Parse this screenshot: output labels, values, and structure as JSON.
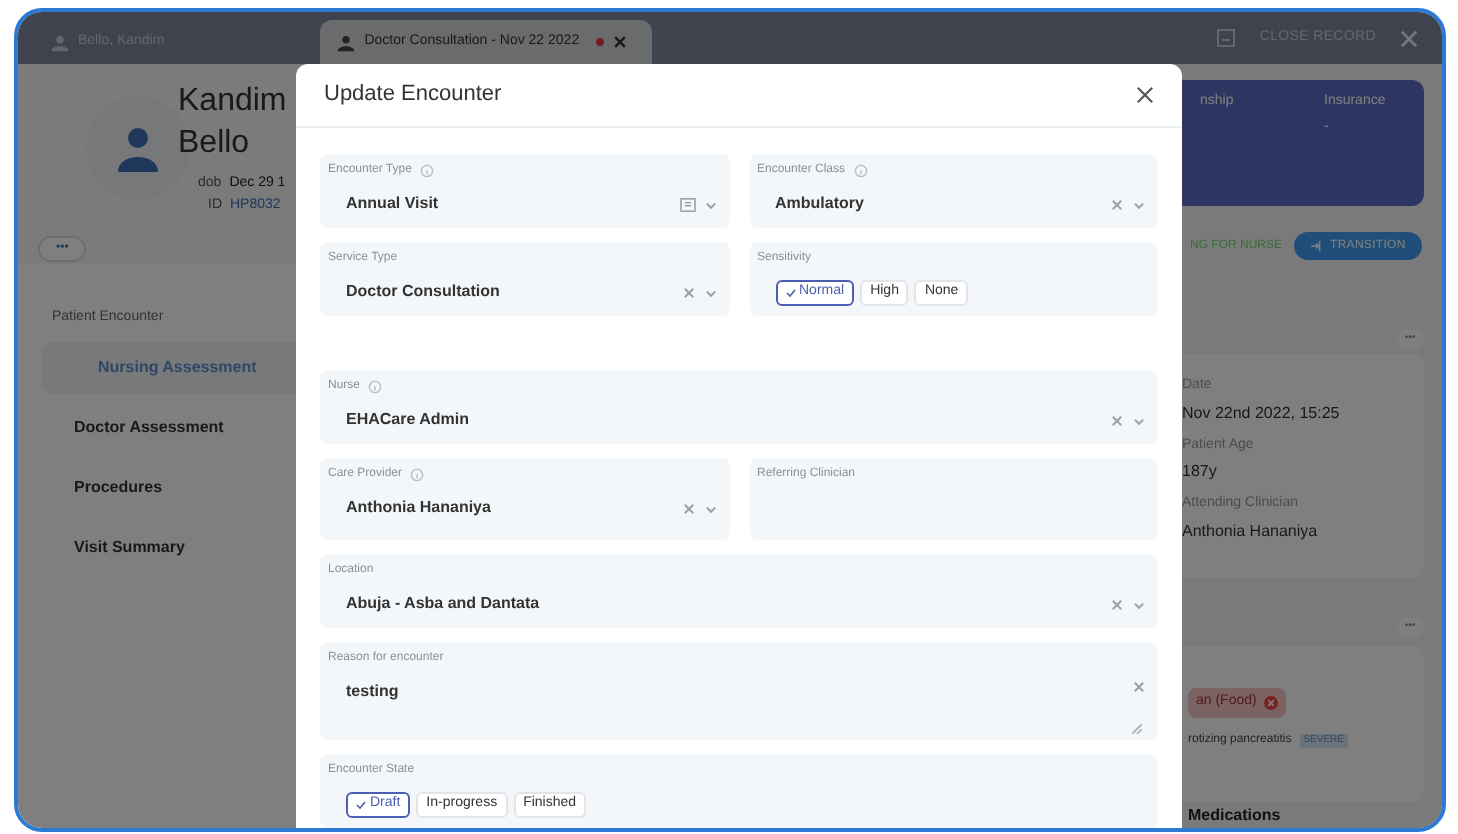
{
  "tabs": [
    {
      "label": "Bello, Kandim",
      "selected": false,
      "unsaved": false,
      "closable": false
    },
    {
      "label": "Doctor Consultation - Nov 22 2022",
      "selected": true,
      "unsaved": true,
      "closable": true
    }
  ],
  "toolbar": {
    "close_record": "CLOSE RECORD"
  },
  "patient": {
    "first_name": "Kandim",
    "last_name": "Bello",
    "dob_label": "dob",
    "dob": "Dec 29 1",
    "id_label": "ID",
    "id": "HP8032",
    "more": "•••"
  },
  "summary_card": {
    "columns": [
      {
        "label": "nship"
      },
      {
        "label": "Insurance",
        "value": "-"
      }
    ]
  },
  "status": "NG FOR NURSE",
  "transition": "TRANSITION",
  "sidebar": {
    "title": "Patient Encounter",
    "items": [
      {
        "label": "Nursing Assessment",
        "selected": true
      },
      {
        "label": "Doctor Assessment",
        "selected": false
      },
      {
        "label": "Procedures",
        "selected": false
      },
      {
        "label": "Visit Summary",
        "selected": false
      }
    ]
  },
  "encounter_card": {
    "more": "•••",
    "fields": [
      {
        "label": "Date",
        "value": "Nov 22nd 2022, 15:25"
      },
      {
        "label": "Patient Age",
        "value": "187y"
      },
      {
        "label": "Attending Clinician",
        "value": "Anthonia Hananiya"
      }
    ]
  },
  "allergy_card": {
    "more": "•••",
    "allergy": "an (Food)",
    "condition": "rotizing pancreatitis",
    "severity": "SEVERE",
    "next_section": "Medications"
  },
  "modal": {
    "title": "Update Encounter",
    "sections": [
      [
        {
          "kind": "select",
          "label": "Encounter Type",
          "info": true,
          "value": "Annual Visit",
          "calendar": true,
          "wide": false
        },
        {
          "kind": "select",
          "label": "Encounter Class",
          "info": true,
          "value": "Ambulatory",
          "clearable": true,
          "wide": false
        },
        {
          "kind": "select",
          "label": "Service Type",
          "value": "Doctor Consultation",
          "clearable": true,
          "wide": false
        },
        {
          "kind": "toggle",
          "label": "Sensitivity",
          "wide": false,
          "options": [
            {
              "label": "Normal",
              "selected": true
            },
            {
              "label": "High",
              "selected": false
            },
            {
              "label": "None",
              "selected": false
            }
          ]
        }
      ],
      [
        {
          "kind": "select",
          "label": "Nurse",
          "info": true,
          "value": "EHACare Admin",
          "clearable": true,
          "wide": true
        },
        {
          "kind": "select",
          "label": "Care Provider",
          "info": true,
          "value": "Anthonia Hananiya",
          "clearable": true,
          "wide": false
        },
        {
          "kind": "input",
          "label": "Referring Clinician",
          "wide": false
        },
        {
          "kind": "select",
          "label": "Location",
          "value": "Abuja - Asba and Dantata",
          "clearable": true,
          "wide": true
        },
        {
          "kind": "textarea",
          "label": "Reason for encounter",
          "value": "testing",
          "clearable": true,
          "wide": true
        },
        {
          "kind": "toggle",
          "label": "Encounter State",
          "wide": true,
          "options": [
            {
              "label": "Draft",
              "selected": true
            },
            {
              "label": "In-progress",
              "selected": false
            },
            {
              "label": "Finished",
              "selected": false
            }
          ]
        }
      ]
    ]
  }
}
